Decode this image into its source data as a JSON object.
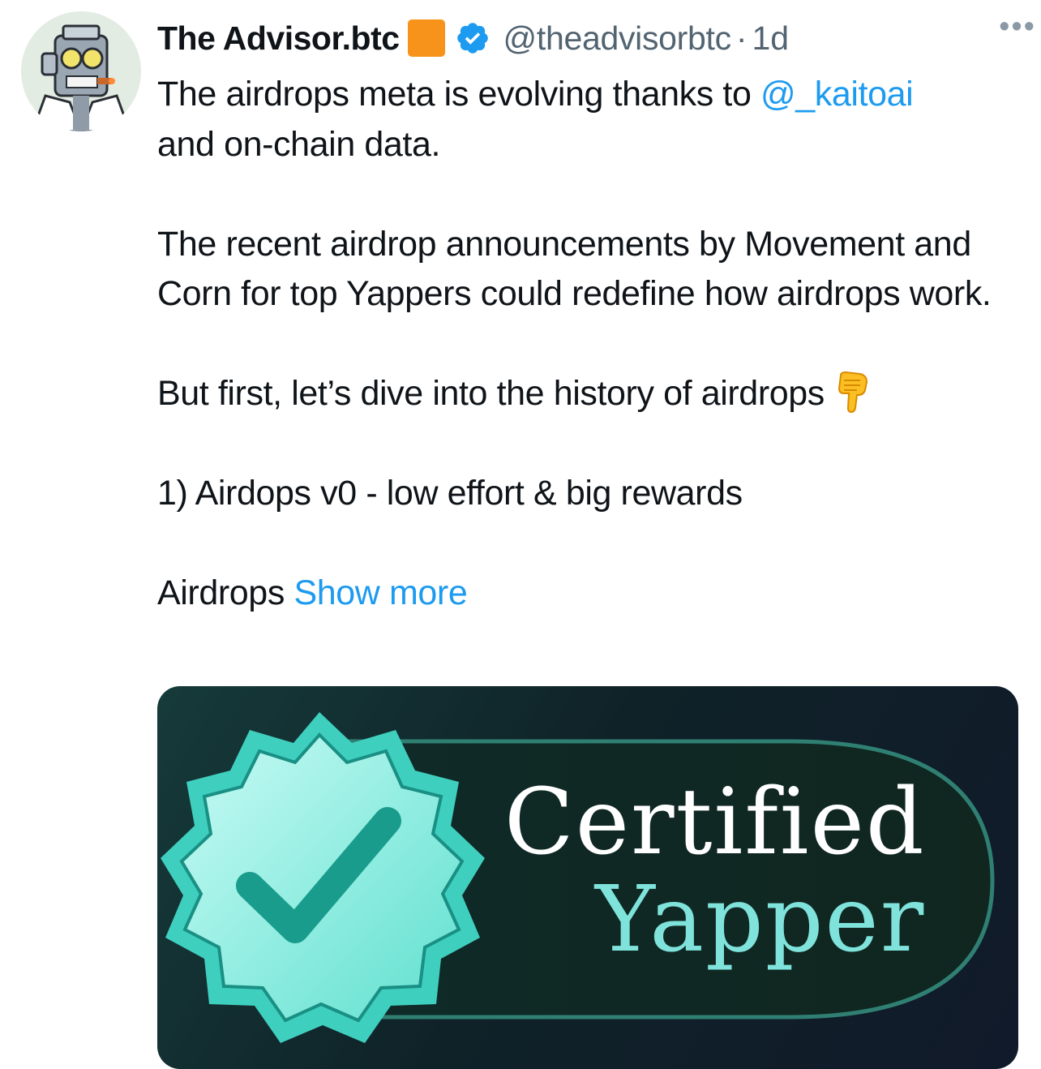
{
  "author": {
    "name": "The Advisor.btc",
    "handle": "@theadvisorbtc",
    "separator": "·",
    "time": "1d",
    "more_label": "•••"
  },
  "icons": {
    "avatar": "robot-avatar-icon",
    "square": "orange-square-icon",
    "verified": "verified-badge-icon",
    "emoji": "backhand-index-pointing-down-icon"
  },
  "colors": {
    "link": "#1d9bf0",
    "muted": "#536471",
    "orange_square": "#f7931a",
    "verified": "#1d9bf0"
  },
  "tweet": {
    "line1_prefix": "The airdrops meta is evolving thanks to ",
    "mention": "@_kaitoai",
    "line1_suffix": "and on-chain data.",
    "paragraph2": "The recent airdrop announcements by Movement and Corn for top Yappers could redefine how airdrops work.",
    "paragraph3": "But first, let’s dive into the history of airdrops",
    "paragraph4": "1) Airdops v0 - low effort & big rewards",
    "paragraph5_prefix": "Airdrops ",
    "show_more": "Show more"
  },
  "media": {
    "line1": "Certified",
    "line2": "Yapper"
  }
}
